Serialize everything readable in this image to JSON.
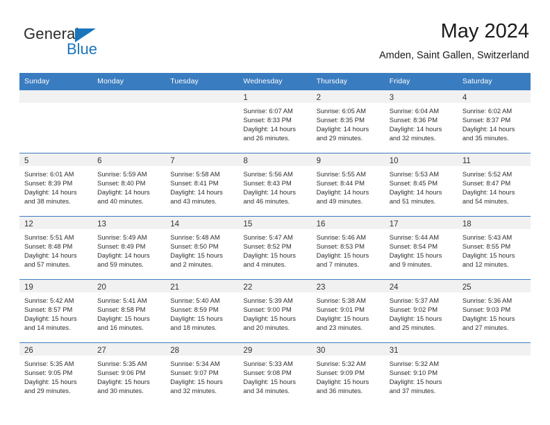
{
  "brand": {
    "name_part1": "General",
    "name_part2": "Blue",
    "accent_color": "#1b75bb"
  },
  "header": {
    "title": "May 2024",
    "subtitle": "Amden, Saint Gallen, Switzerland"
  },
  "calendar": {
    "header_color": "#3a7cc0",
    "weekday_headers": [
      "Sunday",
      "Monday",
      "Tuesday",
      "Wednesday",
      "Thursday",
      "Friday",
      "Saturday"
    ],
    "weeks": [
      [
        {
          "day": "",
          "sunrise": "",
          "sunset": "",
          "daylight": ""
        },
        {
          "day": "",
          "sunrise": "",
          "sunset": "",
          "daylight": ""
        },
        {
          "day": "",
          "sunrise": "",
          "sunset": "",
          "daylight": ""
        },
        {
          "day": "1",
          "sunrise": "Sunrise: 6:07 AM",
          "sunset": "Sunset: 8:33 PM",
          "daylight": "Daylight: 14 hours and 26 minutes."
        },
        {
          "day": "2",
          "sunrise": "Sunrise: 6:05 AM",
          "sunset": "Sunset: 8:35 PM",
          "daylight": "Daylight: 14 hours and 29 minutes."
        },
        {
          "day": "3",
          "sunrise": "Sunrise: 6:04 AM",
          "sunset": "Sunset: 8:36 PM",
          "daylight": "Daylight: 14 hours and 32 minutes."
        },
        {
          "day": "4",
          "sunrise": "Sunrise: 6:02 AM",
          "sunset": "Sunset: 8:37 PM",
          "daylight": "Daylight: 14 hours and 35 minutes."
        }
      ],
      [
        {
          "day": "5",
          "sunrise": "Sunrise: 6:01 AM",
          "sunset": "Sunset: 8:39 PM",
          "daylight": "Daylight: 14 hours and 38 minutes."
        },
        {
          "day": "6",
          "sunrise": "Sunrise: 5:59 AM",
          "sunset": "Sunset: 8:40 PM",
          "daylight": "Daylight: 14 hours and 40 minutes."
        },
        {
          "day": "7",
          "sunrise": "Sunrise: 5:58 AM",
          "sunset": "Sunset: 8:41 PM",
          "daylight": "Daylight: 14 hours and 43 minutes."
        },
        {
          "day": "8",
          "sunrise": "Sunrise: 5:56 AM",
          "sunset": "Sunset: 8:43 PM",
          "daylight": "Daylight: 14 hours and 46 minutes."
        },
        {
          "day": "9",
          "sunrise": "Sunrise: 5:55 AM",
          "sunset": "Sunset: 8:44 PM",
          "daylight": "Daylight: 14 hours and 49 minutes."
        },
        {
          "day": "10",
          "sunrise": "Sunrise: 5:53 AM",
          "sunset": "Sunset: 8:45 PM",
          "daylight": "Daylight: 14 hours and 51 minutes."
        },
        {
          "day": "11",
          "sunrise": "Sunrise: 5:52 AM",
          "sunset": "Sunset: 8:47 PM",
          "daylight": "Daylight: 14 hours and 54 minutes."
        }
      ],
      [
        {
          "day": "12",
          "sunrise": "Sunrise: 5:51 AM",
          "sunset": "Sunset: 8:48 PM",
          "daylight": "Daylight: 14 hours and 57 minutes."
        },
        {
          "day": "13",
          "sunrise": "Sunrise: 5:49 AM",
          "sunset": "Sunset: 8:49 PM",
          "daylight": "Daylight: 14 hours and 59 minutes."
        },
        {
          "day": "14",
          "sunrise": "Sunrise: 5:48 AM",
          "sunset": "Sunset: 8:50 PM",
          "daylight": "Daylight: 15 hours and 2 minutes."
        },
        {
          "day": "15",
          "sunrise": "Sunrise: 5:47 AM",
          "sunset": "Sunset: 8:52 PM",
          "daylight": "Daylight: 15 hours and 4 minutes."
        },
        {
          "day": "16",
          "sunrise": "Sunrise: 5:46 AM",
          "sunset": "Sunset: 8:53 PM",
          "daylight": "Daylight: 15 hours and 7 minutes."
        },
        {
          "day": "17",
          "sunrise": "Sunrise: 5:44 AM",
          "sunset": "Sunset: 8:54 PM",
          "daylight": "Daylight: 15 hours and 9 minutes."
        },
        {
          "day": "18",
          "sunrise": "Sunrise: 5:43 AM",
          "sunset": "Sunset: 8:55 PM",
          "daylight": "Daylight: 15 hours and 12 minutes."
        }
      ],
      [
        {
          "day": "19",
          "sunrise": "Sunrise: 5:42 AM",
          "sunset": "Sunset: 8:57 PM",
          "daylight": "Daylight: 15 hours and 14 minutes."
        },
        {
          "day": "20",
          "sunrise": "Sunrise: 5:41 AM",
          "sunset": "Sunset: 8:58 PM",
          "daylight": "Daylight: 15 hours and 16 minutes."
        },
        {
          "day": "21",
          "sunrise": "Sunrise: 5:40 AM",
          "sunset": "Sunset: 8:59 PM",
          "daylight": "Daylight: 15 hours and 18 minutes."
        },
        {
          "day": "22",
          "sunrise": "Sunrise: 5:39 AM",
          "sunset": "Sunset: 9:00 PM",
          "daylight": "Daylight: 15 hours and 20 minutes."
        },
        {
          "day": "23",
          "sunrise": "Sunrise: 5:38 AM",
          "sunset": "Sunset: 9:01 PM",
          "daylight": "Daylight: 15 hours and 23 minutes."
        },
        {
          "day": "24",
          "sunrise": "Sunrise: 5:37 AM",
          "sunset": "Sunset: 9:02 PM",
          "daylight": "Daylight: 15 hours and 25 minutes."
        },
        {
          "day": "25",
          "sunrise": "Sunrise: 5:36 AM",
          "sunset": "Sunset: 9:03 PM",
          "daylight": "Daylight: 15 hours and 27 minutes."
        }
      ],
      [
        {
          "day": "26",
          "sunrise": "Sunrise: 5:35 AM",
          "sunset": "Sunset: 9:05 PM",
          "daylight": "Daylight: 15 hours and 29 minutes."
        },
        {
          "day": "27",
          "sunrise": "Sunrise: 5:35 AM",
          "sunset": "Sunset: 9:06 PM",
          "daylight": "Daylight: 15 hours and 30 minutes."
        },
        {
          "day": "28",
          "sunrise": "Sunrise: 5:34 AM",
          "sunset": "Sunset: 9:07 PM",
          "daylight": "Daylight: 15 hours and 32 minutes."
        },
        {
          "day": "29",
          "sunrise": "Sunrise: 5:33 AM",
          "sunset": "Sunset: 9:08 PM",
          "daylight": "Daylight: 15 hours and 34 minutes."
        },
        {
          "day": "30",
          "sunrise": "Sunrise: 5:32 AM",
          "sunset": "Sunset: 9:09 PM",
          "daylight": "Daylight: 15 hours and 36 minutes."
        },
        {
          "day": "31",
          "sunrise": "Sunrise: 5:32 AM",
          "sunset": "Sunset: 9:10 PM",
          "daylight": "Daylight: 15 hours and 37 minutes."
        },
        {
          "day": "",
          "sunrise": "",
          "sunset": "",
          "daylight": ""
        }
      ]
    ]
  }
}
